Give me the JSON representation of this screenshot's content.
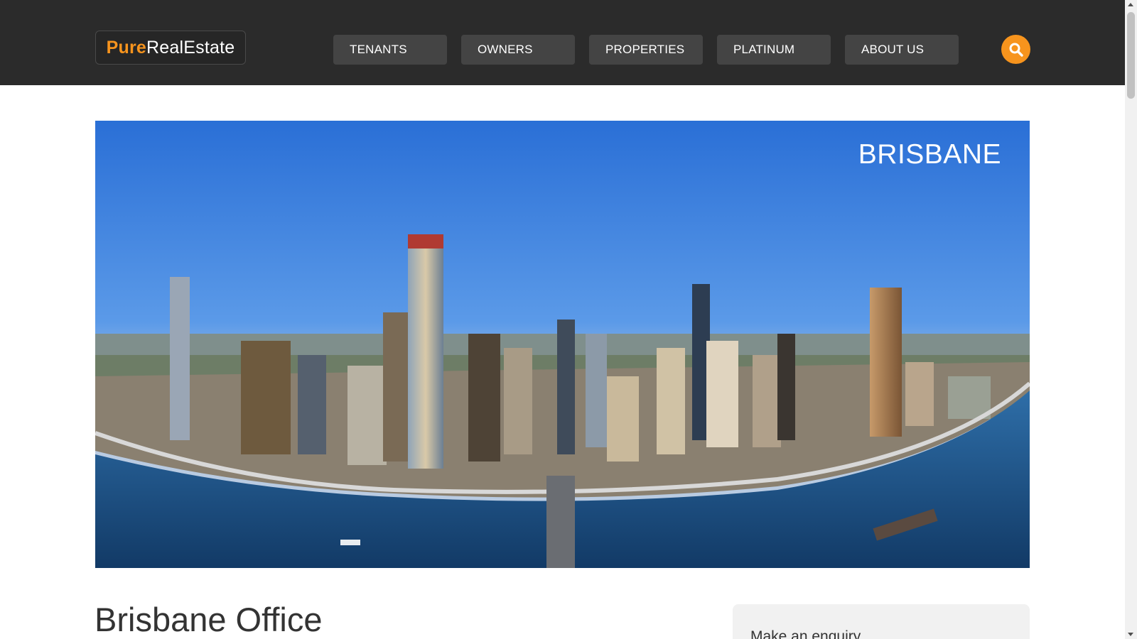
{
  "header": {
    "logo": {
      "part1": "Pure",
      "part2": "RealEstate"
    },
    "nav": [
      {
        "label": "TENANTS"
      },
      {
        "label": "OWNERS"
      },
      {
        "label": "PROPERTIES"
      },
      {
        "label": "PLATINUM"
      },
      {
        "label": "ABOUT US"
      }
    ],
    "search_icon": "search-icon"
  },
  "hero": {
    "title": "BRISBANE",
    "image": "brisbane-city-skyline-aerial-photo"
  },
  "main": {
    "title": "Brisbane Office",
    "enquiry_label": "Make an enquiry"
  },
  "colors": {
    "accent": "#f7941d",
    "header_bg": "#2b2b2b",
    "nav_button_bg": "#444444"
  }
}
